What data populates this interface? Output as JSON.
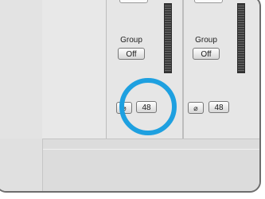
{
  "channels": [
    {
      "value": "0",
      "group_label": "Group",
      "group_state": "Off",
      "phase_icon": "⌀",
      "input_value": "48"
    },
    {
      "value": "20",
      "group_label": "Group",
      "group_state": "Off",
      "phase_icon": "⌀",
      "input_value": "48"
    }
  ],
  "colors": {
    "highlight": "#1ea0e0",
    "panel": "#e6e6e6",
    "frame": "#6d6d6d"
  }
}
